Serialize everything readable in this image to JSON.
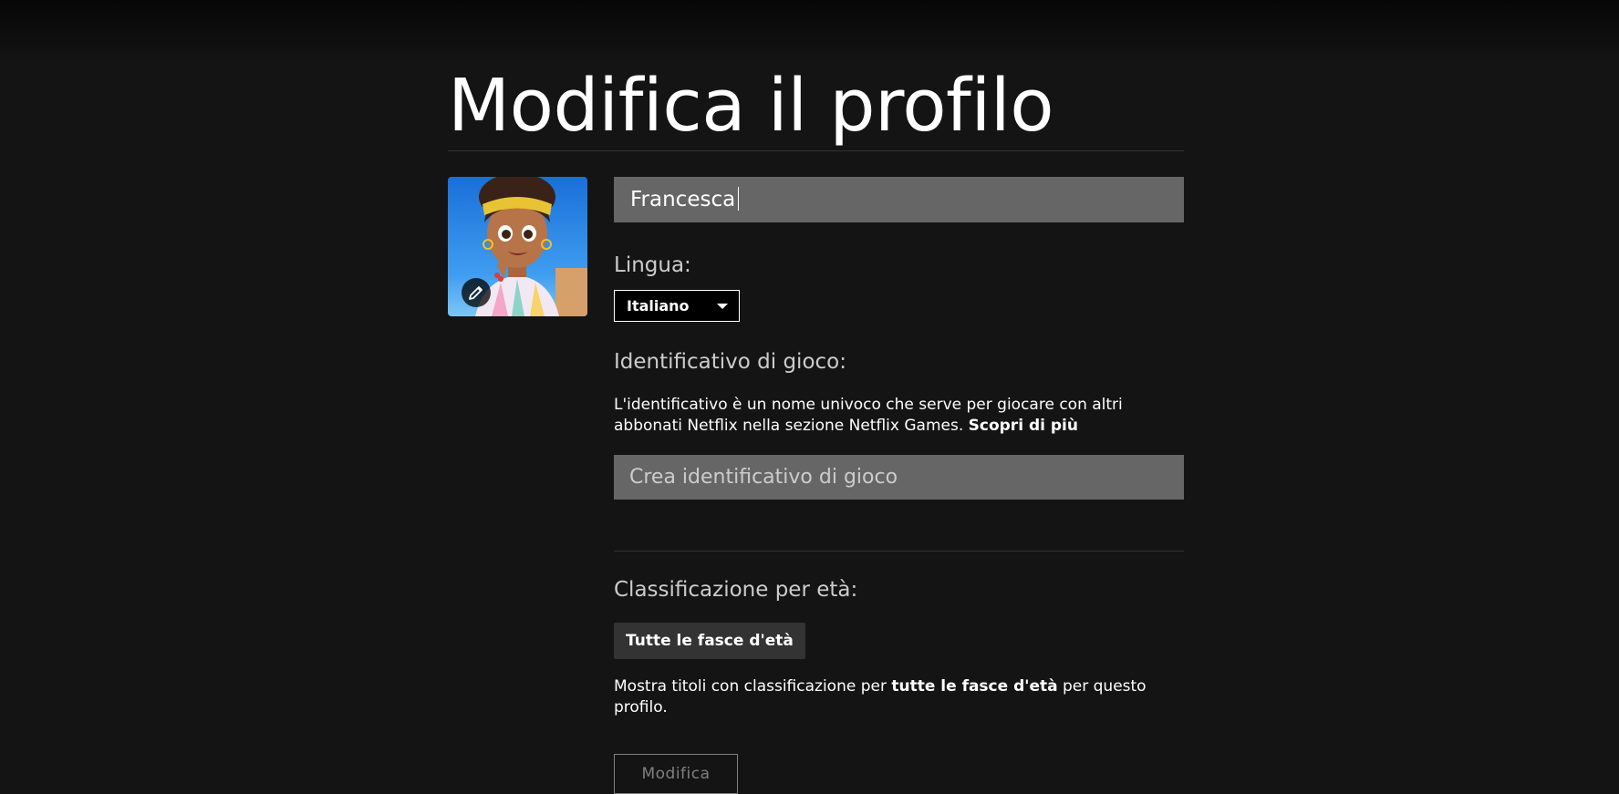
{
  "page": {
    "title": "Modifica il profilo"
  },
  "avatar": {
    "edit_icon": "pencil-icon"
  },
  "profile": {
    "name_value": "Francesca"
  },
  "language": {
    "label": "Lingua:",
    "selected": "Italiano",
    "chevron_icon": "caret-down-icon"
  },
  "gamer": {
    "label": "Identificativo di gioco:",
    "description": "L'identificativo è un nome univoco che serve per giocare con altri abbonati Netflix nella sezione Netflix Games.",
    "learn_more": "Scopri di più",
    "placeholder": "Crea identificativo di gioco"
  },
  "maturity": {
    "label": "Classificazione per età:",
    "badge": "Tutte le fasce d'età",
    "desc_before": "Mostra titoli con classificazione per",
    "desc_bold": "tutte le fasce d'età",
    "desc_after": "per questo profilo.",
    "edit_button": "Modifica"
  },
  "colors": {
    "background": "#141414",
    "input_bg": "#666666",
    "badge_bg": "#333333",
    "label_text": "#cccccc",
    "disabled_text": "#808080"
  }
}
